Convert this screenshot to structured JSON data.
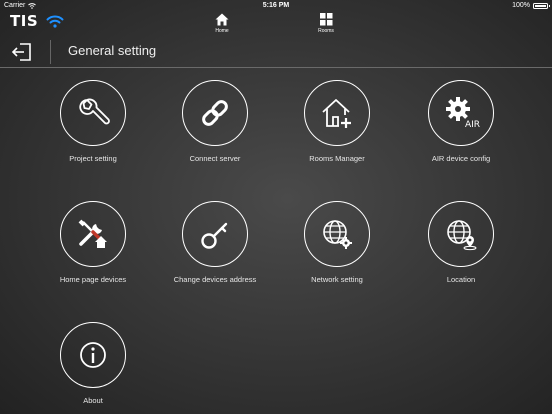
{
  "status": {
    "carrier": "Carrier",
    "time": "5:16 PM",
    "battery": "100%"
  },
  "brand": {
    "logo": "TIS"
  },
  "nav": [
    {
      "label": "Home",
      "icon": "home-icon"
    },
    {
      "label": "Rooms",
      "icon": "grid-icon"
    }
  ],
  "header": {
    "title": "General setting"
  },
  "items": [
    {
      "label": "Project setting",
      "icon": "wrench-icon"
    },
    {
      "label": "Connect server",
      "icon": "link-icon"
    },
    {
      "label": "Rooms Manager",
      "icon": "house-plus-icon"
    },
    {
      "label": "AIR device config",
      "icon": "gear-air-icon",
      "badge": "AIR"
    },
    {
      "label": "Home page devices",
      "icon": "tools-house-icon"
    },
    {
      "label": "Change devices address",
      "icon": "key-icon"
    },
    {
      "label": "Network setting",
      "icon": "globe-gear-icon"
    },
    {
      "label": "Location",
      "icon": "globe-pin-icon"
    },
    {
      "label": "About",
      "icon": "info-icon"
    }
  ],
  "colors": {
    "background": "#3a3a3a",
    "foreground": "#ffffff",
    "wifi": "#1e90ff"
  }
}
